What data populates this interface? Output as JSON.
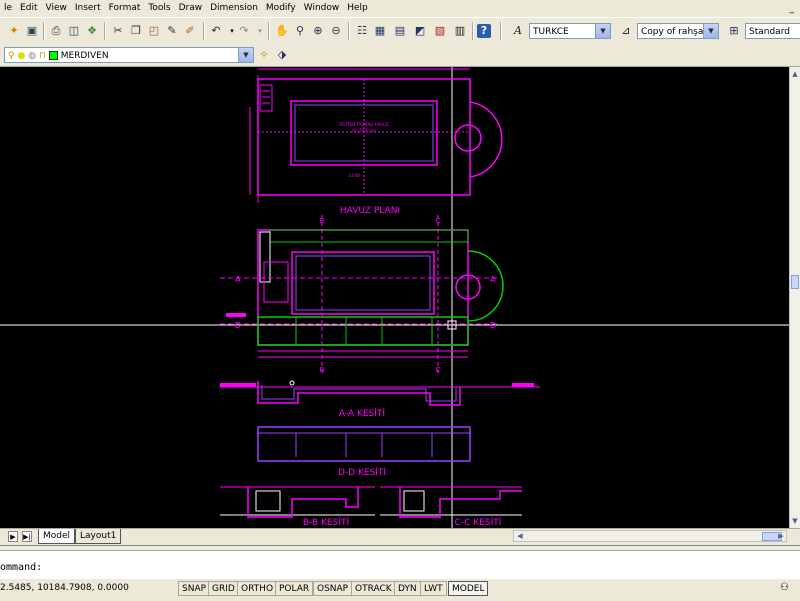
{
  "menubar": {
    "items": [
      "le",
      "Edit",
      "View",
      "Insert",
      "Format",
      "Tools",
      "Draw",
      "Dimension",
      "Modify",
      "Window",
      "Help"
    ],
    "window_control": "_"
  },
  "toolbar": {
    "text_style": "TURKCE",
    "dim_style": "Copy of rahşan",
    "table_style": "Standard",
    "icons": [
      "new-icon",
      "save-icon",
      "print-icon",
      "preview-icon",
      "publish-icon",
      "cut-icon",
      "copy-icon",
      "paste-icon",
      "matchprop-icon",
      "blockeditor-icon",
      "undo-icon",
      "redo-icon",
      "pan-icon",
      "zoom-realtime-icon",
      "zoom-window-icon",
      "zoom-previous-icon",
      "properties-icon",
      "designcenter-icon",
      "toolpalettes-icon",
      "sheetset-icon",
      "markup-icon",
      "calculator-icon",
      "help-icon"
    ]
  },
  "layers": {
    "current": "MERDIVEN"
  },
  "drawing": {
    "plan_title": "HAVUZ PLANI",
    "section_aa": "A-A KESİTİ",
    "section_dd": "D-D KESİTİ",
    "section_bb": "B-B KESİTİ",
    "section_cc": "C-C KESİTİ",
    "marker_a": "A",
    "marker_d": "D",
    "marker_b": "B",
    "marker_c": "C",
    "pool_label": "ÜSTTEN TAŞMALI HAVUZ",
    "pool_sub": "(h=160 cm)",
    "dim_label": "14.00",
    "colors": {
      "magenta": "#ff00ff",
      "purple": "#a040ff",
      "green": "#00d000",
      "white": "#ffffff",
      "red": "#ff3030",
      "yellow": "#ffff00"
    }
  },
  "tabs": {
    "model": "Model",
    "layout1": "Layout1"
  },
  "command": {
    "prompt": "ommand:"
  },
  "status": {
    "coordinates": "2.5485, 10184.7908, 0.0000",
    "buttons": [
      "SNAP",
      "GRID",
      "ORTHO",
      "POLAR",
      "OSNAP",
      "OTRACK",
      "DYN",
      "LWT",
      "MODEL"
    ]
  }
}
